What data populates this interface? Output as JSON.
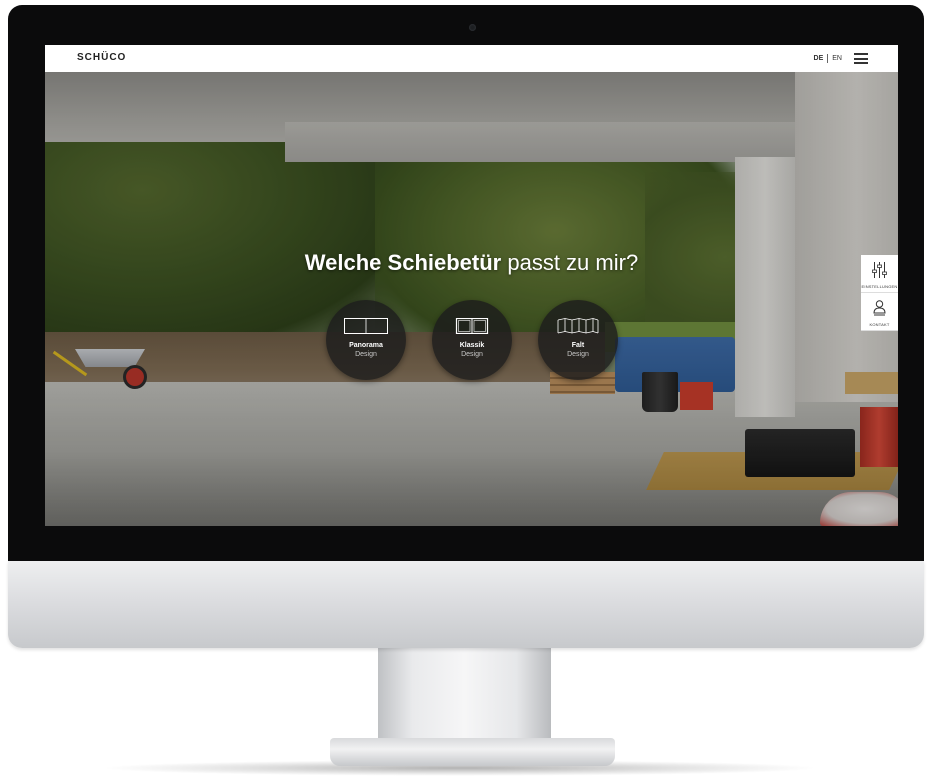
{
  "header": {
    "logo_text": "SCHÜCO",
    "lang_active": "DE",
    "lang_other": "EN"
  },
  "hero": {
    "title_strong": "Welche Schiebetür",
    "title_light": "passt zu mir?"
  },
  "options": [
    {
      "line1": "Panorama",
      "line2": "Design",
      "icon": "panorama-door-icon"
    },
    {
      "line1": "Klassik",
      "line2": "Design",
      "icon": "classic-door-icon"
    },
    {
      "line1": "Falt",
      "line2": "Design",
      "icon": "folding-door-icon"
    }
  ],
  "side_tools": [
    {
      "label": "EINSTELLUNGEN",
      "icon": "sliders-icon"
    },
    {
      "label": "KONTAKT",
      "icon": "contact-icon"
    }
  ]
}
